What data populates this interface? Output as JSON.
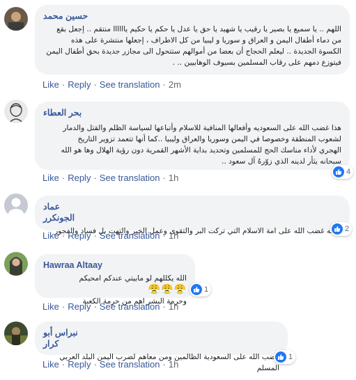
{
  "ui": {
    "like": "Like",
    "reply": "Reply",
    "see_translation": "See translation",
    "separator": "·"
  },
  "comments": [
    {
      "author": "حسين محمد",
      "lines": [
        "اللهم .. يا سميع يا بصير يا رقيب يا شهيد يا حق يا عدل يا حكم يا حكيم ياااااا منتقم .. إجعل بقع",
        "من دماء أطفال اليمن و العراق و سوريا و ليبيا من كل الاطراف ، إجعلها منتشرة على هذه",
        "الكسوة الجديدة .. ليعلم الحجاج أن بعضا من أموالهم ستتحول الى مجازر جديدة بحق أطفال اليمن",
        "فيتوزع دمهم على رقاب المسلمين بسيوف الوهابيين .. ."
      ],
      "time": "2m"
    },
    {
      "author": "بحر العطاء",
      "lines": [
        "هذا غضب الله على السعوديه وأفعالها المنافية للاسلام وأتباعها لسياسة الظلم والقتل والدمار",
        "لشعوب المنطقة وخصوصا في اليمن وسوريا والعراق وليبيا ..كما أنها تتعمد تزوير التاريخ",
        "الهجري لأداء مناسك الحج للمسلمين وتحديد بداية الأشهر القمرية دون رؤية الهلال وها هو الله",
        "سبحانه يثأر لدينه الذي زوّرهُ آل سعود .."
      ],
      "time": "1h",
      "reactions": "4"
    },
    {
      "author": "عماد الجونكرر",
      "lines": [
        "لا انه غضب الله على امة الاسلام التي تركت البر والتقوى وعمل الخير والتهت بل فساد والفجور"
      ],
      "time": "1h",
      "reactions": "2"
    },
    {
      "author": "Hawraa Altaay",
      "lines": [
        "الله يكللهم لو مابيتي عندكم امحيكم",
        "وحرمة البشر اهم من حرمة الكعبة"
      ],
      "emoji": "😤😤😤",
      "time": "1h",
      "reactions": "1"
    },
    {
      "author": "نبراس أبو كرار",
      "lines": [
        "غضب الله على السعودية الظالمين ومن معاهم لضرب اليمن البلد العربي المسلم"
      ],
      "time": "1h",
      "reactions": "1"
    }
  ]
}
